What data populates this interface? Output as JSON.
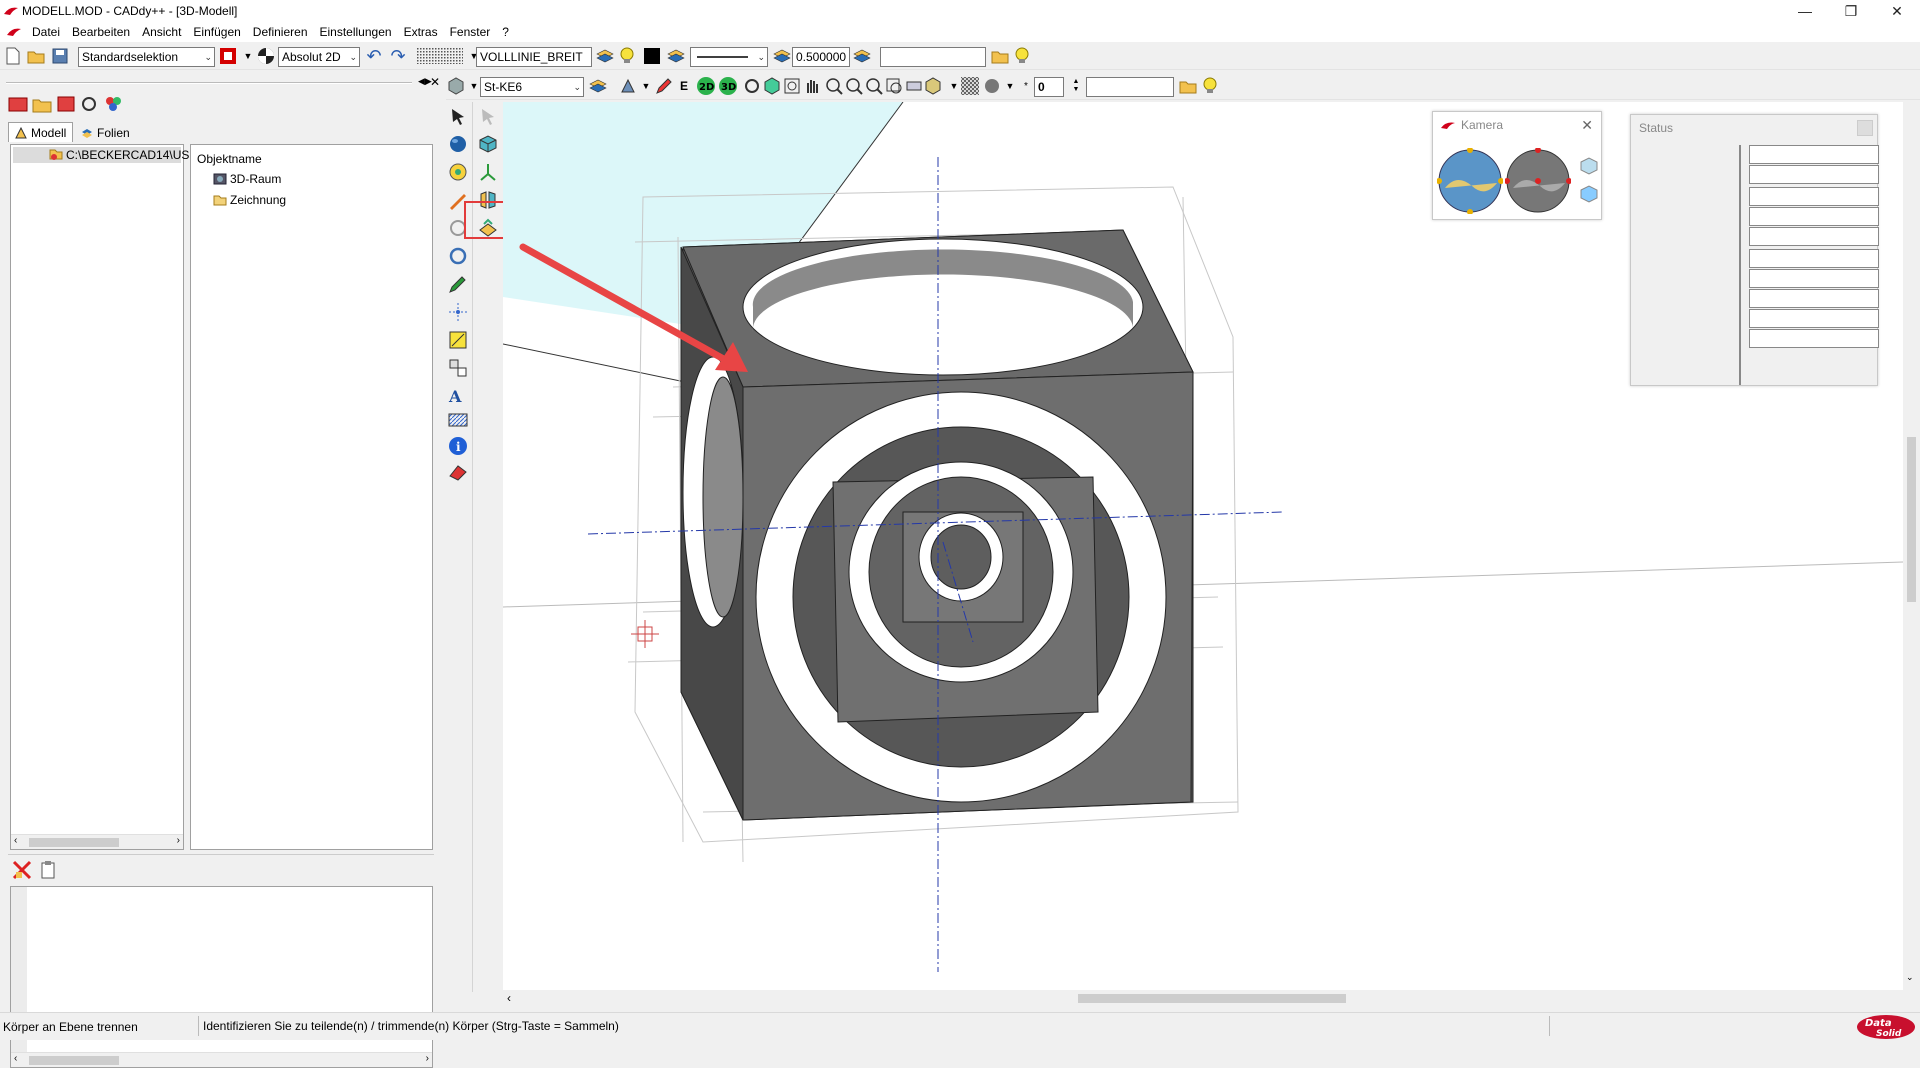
{
  "window": {
    "title": "MODELL.MOD  -  CADdy++ - [3D-Modell]"
  },
  "menu": {
    "items": [
      "Datei",
      "Bearbeiten",
      "Ansicht",
      "Einfügen",
      "Definieren",
      "Einstellungen",
      "Extras",
      "Fenster",
      "?"
    ]
  },
  "toolbar1": {
    "selection_mode": "Standardselektion",
    "coord_mode": "Absolut 2D",
    "linetype": "VOLLLINIE_BREIT",
    "line_width": "0.500000",
    "layer_field": ""
  },
  "toolbar2": {
    "material": "St-KE6",
    "count_value": "0",
    "extra_field": ""
  },
  "left_panel": {
    "tabs": [
      {
        "label": "Modell"
      },
      {
        "label": "Folien"
      }
    ],
    "path": "C:\\BECKERCAD14\\US",
    "column_header": "Objektname",
    "tree": [
      {
        "label": "3D-Raum"
      },
      {
        "label": "Zeichnung"
      }
    ]
  },
  "camera_window": {
    "title": "Kamera"
  },
  "status_window": {
    "title": "Status"
  },
  "statusbar": {
    "command": "Körper an Ebene trennen",
    "prompt": "Identifizieren Sie zu teilende(n) / trimmende(n) Körper (Strg-Taste = Sammeln)"
  },
  "brand": {
    "logo_text": "Data Solid",
    "accent": "#c8102e"
  },
  "colors": {
    "highlight_box": "#e23b3b",
    "arrow": "#e84545",
    "solid_face": "#6b6b6b",
    "plane": "#d6f6f8"
  }
}
